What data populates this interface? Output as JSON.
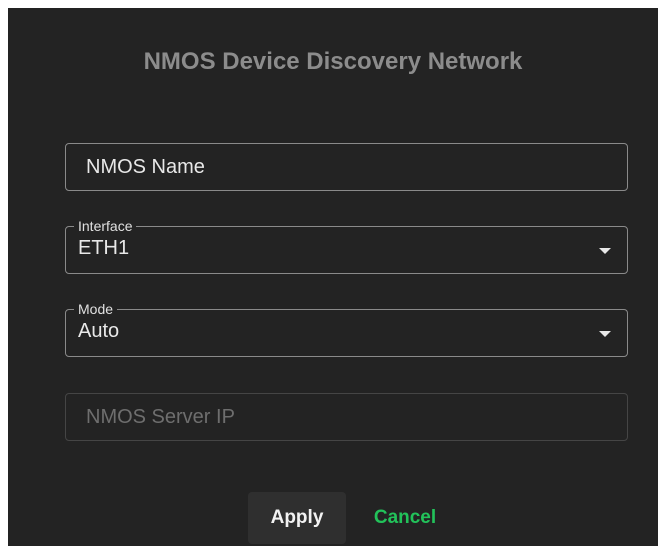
{
  "dialog": {
    "title": "NMOS Device Discovery Network"
  },
  "fields": {
    "nmos_name": {
      "placeholder": "NMOS Name",
      "value": ""
    },
    "interface": {
      "label": "Interface",
      "value": "ETH1"
    },
    "mode": {
      "label": "Mode",
      "value": "Auto"
    },
    "nmos_server_ip": {
      "placeholder": "NMOS Server IP",
      "value": "",
      "disabled": true
    }
  },
  "buttons": {
    "apply": "Apply",
    "cancel": "Cancel"
  },
  "colors": {
    "background": "#232323",
    "title": "#8c8c8c",
    "accent_cancel": "#22c25a"
  },
  "icons": {
    "select_caret": "caret-down-icon"
  }
}
